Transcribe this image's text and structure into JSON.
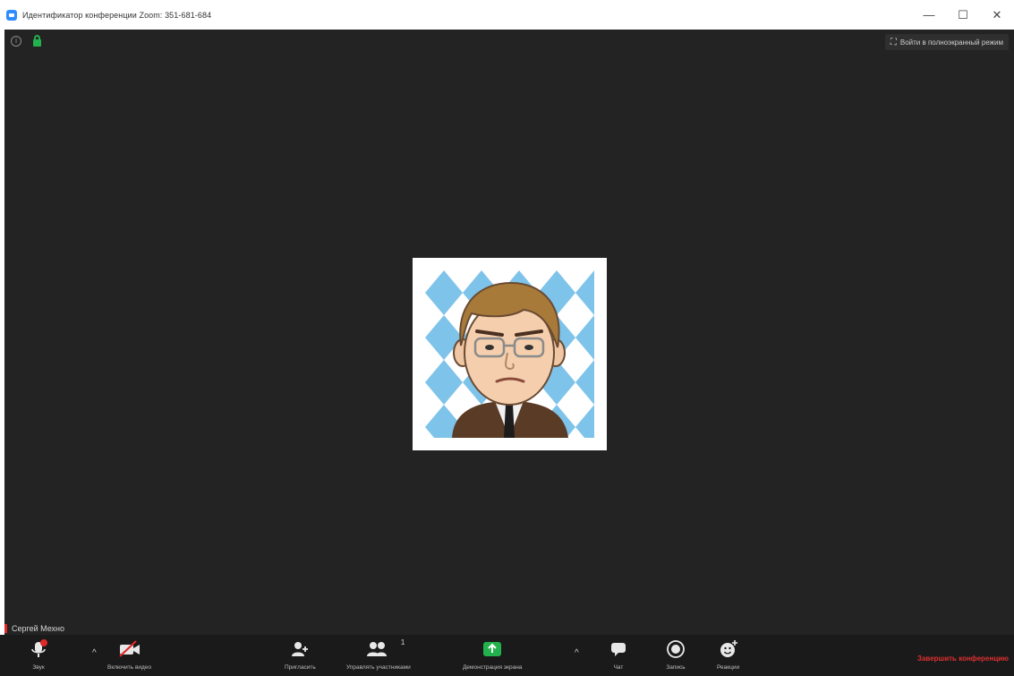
{
  "window": {
    "title": "Идентификатор конференции Zoom: 351-681-684",
    "controls": {
      "minimize": "—",
      "maximize": "☐",
      "close": "✕"
    }
  },
  "meeting": {
    "fullscreen_label": "Войти в полноэкранный режим",
    "participant_name": "Сергей Мехно",
    "avatar": {
      "background_color": "#7ec3ea",
      "frame_color": "#ffffff"
    }
  },
  "toolbar": {
    "audio_label": "Звук",
    "video_label": "Включить видео",
    "invite_label": "Пригласить",
    "participants_label": "Управлять участниками",
    "participants_count": "1",
    "share_label": "Демонстрация экрана",
    "chat_label": "Чат",
    "record_label": "Запись",
    "reactions_label": "Реакции",
    "end_label": "Завершить конференцию",
    "colors": {
      "share": "#22b14c",
      "end": "#e03030"
    }
  }
}
